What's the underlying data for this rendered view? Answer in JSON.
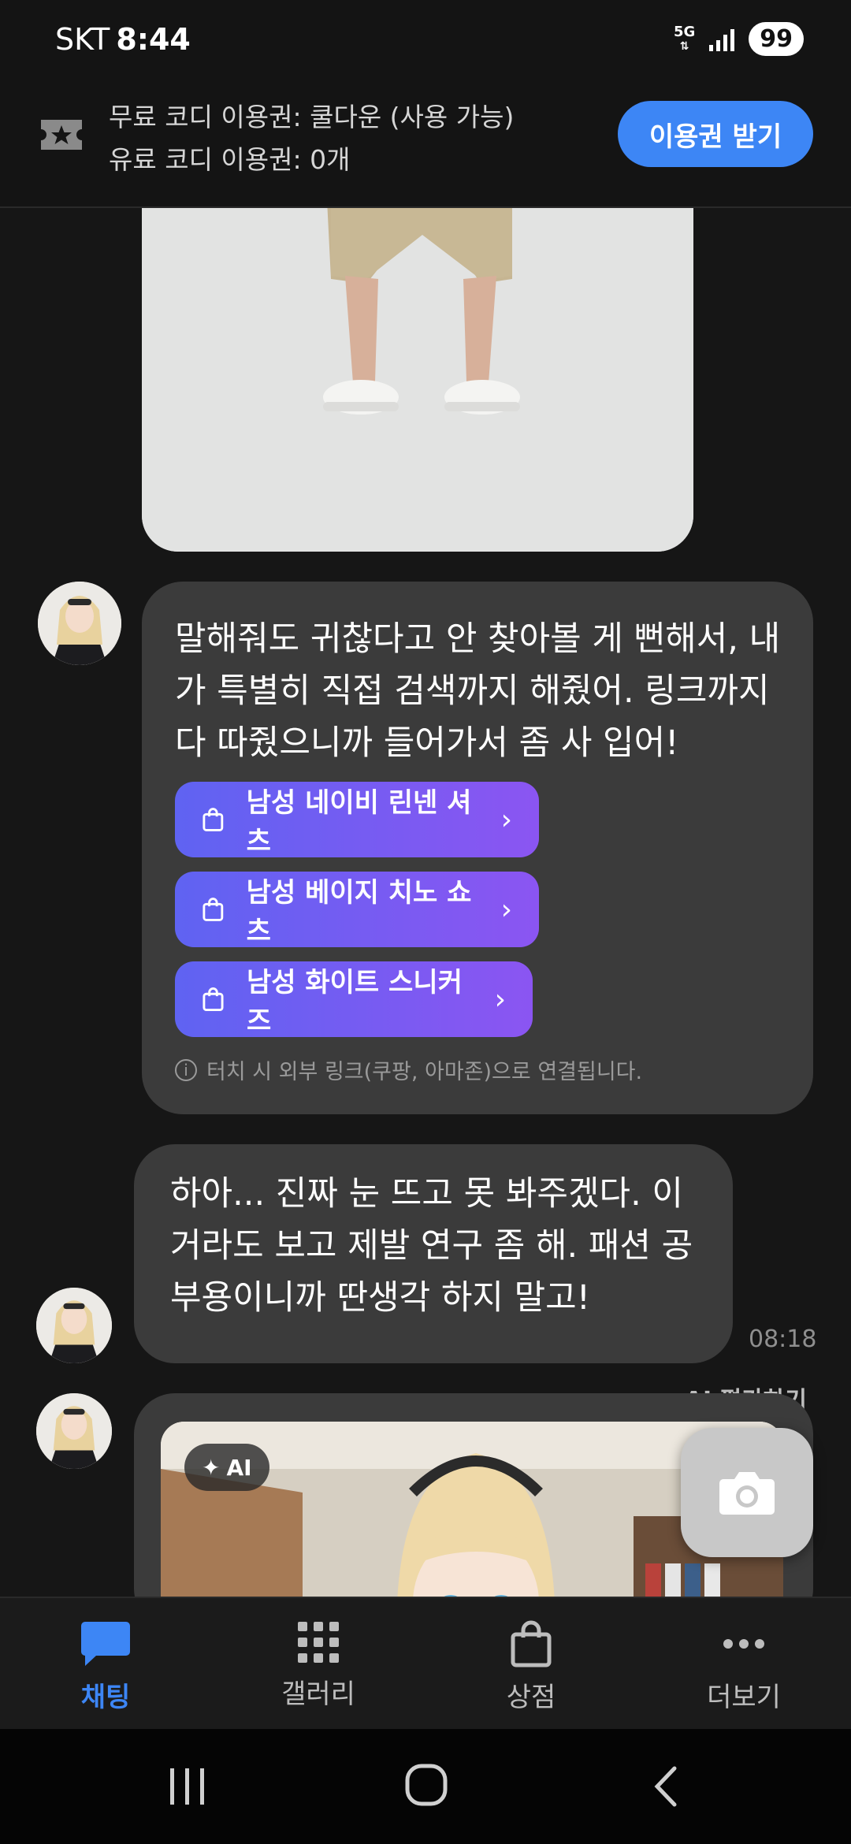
{
  "status_bar": {
    "carrier": "SKT",
    "time": "8:44",
    "network": "5G",
    "battery": "99"
  },
  "coupon_bar": {
    "free_line": "무료 코디 이용권: 쿨다운 (사용 가능)",
    "paid_line": "유료 코디 이용권: 0개",
    "get_button": "이용권 받기"
  },
  "messages": {
    "msg1": {
      "text": "말해줘도 귀찮다고 안 찾아볼 게 뻔해서, 내가 특별히 직접 검색까지 해줬어. 링크까지 다 따줬으니까 들어가서 좀 사 입어!",
      "links": [
        {
          "label": "남성 네이비 린넨 셔츠"
        },
        {
          "label": "남성 베이지 치노 쇼츠"
        },
        {
          "label": "남성 화이트 스니커즈"
        }
      ],
      "notice": "터치 시 외부 링크(쿠팡, 아마존)으로 연결됩니다."
    },
    "msg2": {
      "text": "하아... 진짜 눈 뜨고 못 봐주겠다. 이거라도 보고 제발 연구 좀 해. 패션 공부용이니까 딴생각 하지 말고!",
      "time": "08:18"
    },
    "msg3": {
      "rate_label": "AI 평가하기",
      "badge": "AI"
    }
  },
  "tabs": [
    {
      "label": "채팅",
      "icon": "chat-icon",
      "active": true
    },
    {
      "label": "갤러리",
      "icon": "grid-icon",
      "active": false
    },
    {
      "label": "상점",
      "icon": "shopping-bag-icon",
      "active": false
    },
    {
      "label": "더보기",
      "icon": "more-icon",
      "active": false
    }
  ],
  "colors": {
    "accent": "#3d86f5",
    "link_gradient_start": "#5f63f2",
    "link_gradient_end": "#8b55f2",
    "bubble": "#3b3b3b",
    "background": "#161616"
  }
}
